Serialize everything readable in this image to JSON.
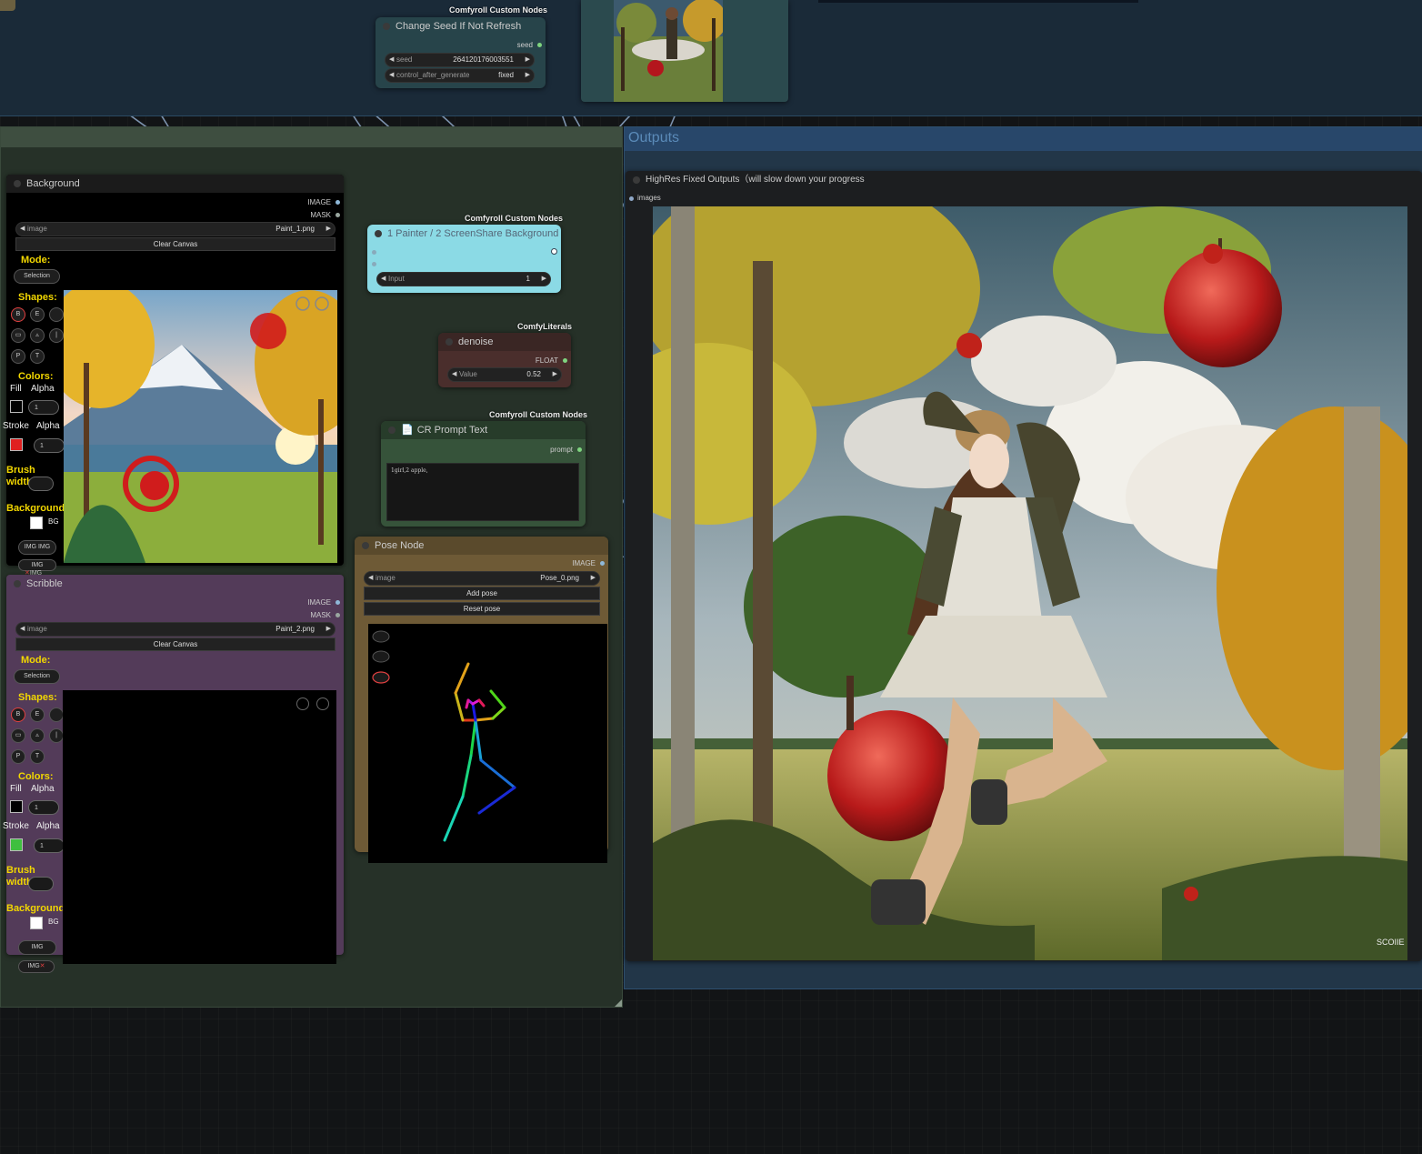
{
  "top_node": {
    "badge": "Comfyroll Custom Nodes",
    "title": "Change Seed If Not Refresh",
    "output": "seed",
    "widgets": [
      {
        "label": "seed",
        "value": "264120176003551"
      },
      {
        "label": "control_after_generate",
        "value": "fixed"
      }
    ]
  },
  "outputs_group": {
    "title": "Outputs",
    "node_title": "HighRes Fixed Outputs（will slow down your progress",
    "input": "images"
  },
  "background_node": {
    "title": "Background",
    "outputs": [
      "IMAGE",
      "MASK"
    ],
    "image_label": "image",
    "image_value": "Paint_1.png",
    "clear_canvas": "Clear Canvas",
    "mode_label": "Mode:",
    "mode_value": "Selection",
    "shapes_label": "Shapes:",
    "shape_buttons": [
      "B",
      "E",
      "P",
      "T"
    ],
    "colors_label": "Colors:",
    "fill_label": "Fill",
    "alpha_label": "Alpha",
    "fill_alpha": "1",
    "stroke_label": "Stroke",
    "stroke_alpha": "1",
    "brush_width_label": "Brush width:",
    "background_label": "Background:",
    "bg_label": "BG",
    "img_buttons": [
      "IMG IMG",
      "公用",
      "IMG",
      "IMG"
    ],
    "colors": {
      "fill": "#000000",
      "stroke": "#e02020"
    }
  },
  "scribble_node": {
    "title": "Scribble",
    "outputs": [
      "IMAGE",
      "MASK"
    ],
    "image_label": "image",
    "image_value": "Paint_2.png",
    "clear_canvas": "Clear Canvas",
    "mode_label": "Mode:",
    "mode_value": "Selection",
    "shapes_label": "Shapes:",
    "shape_buttons": [
      "B",
      "E",
      "P",
      "T"
    ],
    "colors_label": "Colors:",
    "fill_label": "Fill",
    "alpha_label": "Alpha",
    "fill_alpha": "1",
    "stroke_label": "Stroke",
    "stroke_alpha": "1",
    "brush_width_label": "Brush width:",
    "background_label": "Background:",
    "bg_label": "BG",
    "img_buttons": [
      "IMG",
      "IMG"
    ],
    "colors": {
      "fill": "#000000",
      "stroke": "#3fbf3f"
    }
  },
  "painter_node": {
    "badge": "Comfyroll Custom Nodes",
    "title": "1 Painter / 2 ScreenShare Background",
    "widget_label": "Input",
    "widget_value": "1"
  },
  "denoise_node": {
    "badge": "ComfyLiterals",
    "title": "denoise",
    "output": "FLOAT",
    "widget_label": "Value",
    "widget_value": "0.52"
  },
  "prompt_node": {
    "badge": "Comfyroll Custom Nodes",
    "title": "CR Prompt Text",
    "output": "prompt",
    "text": "1girl,2 apple,"
  },
  "pose_node": {
    "title": "Pose Node",
    "output": "IMAGE",
    "image_label": "image",
    "image_value": "Pose_0.png",
    "add_pose": "Add pose",
    "reset_pose": "Reset pose"
  },
  "image_watermark": "SCOIIE"
}
